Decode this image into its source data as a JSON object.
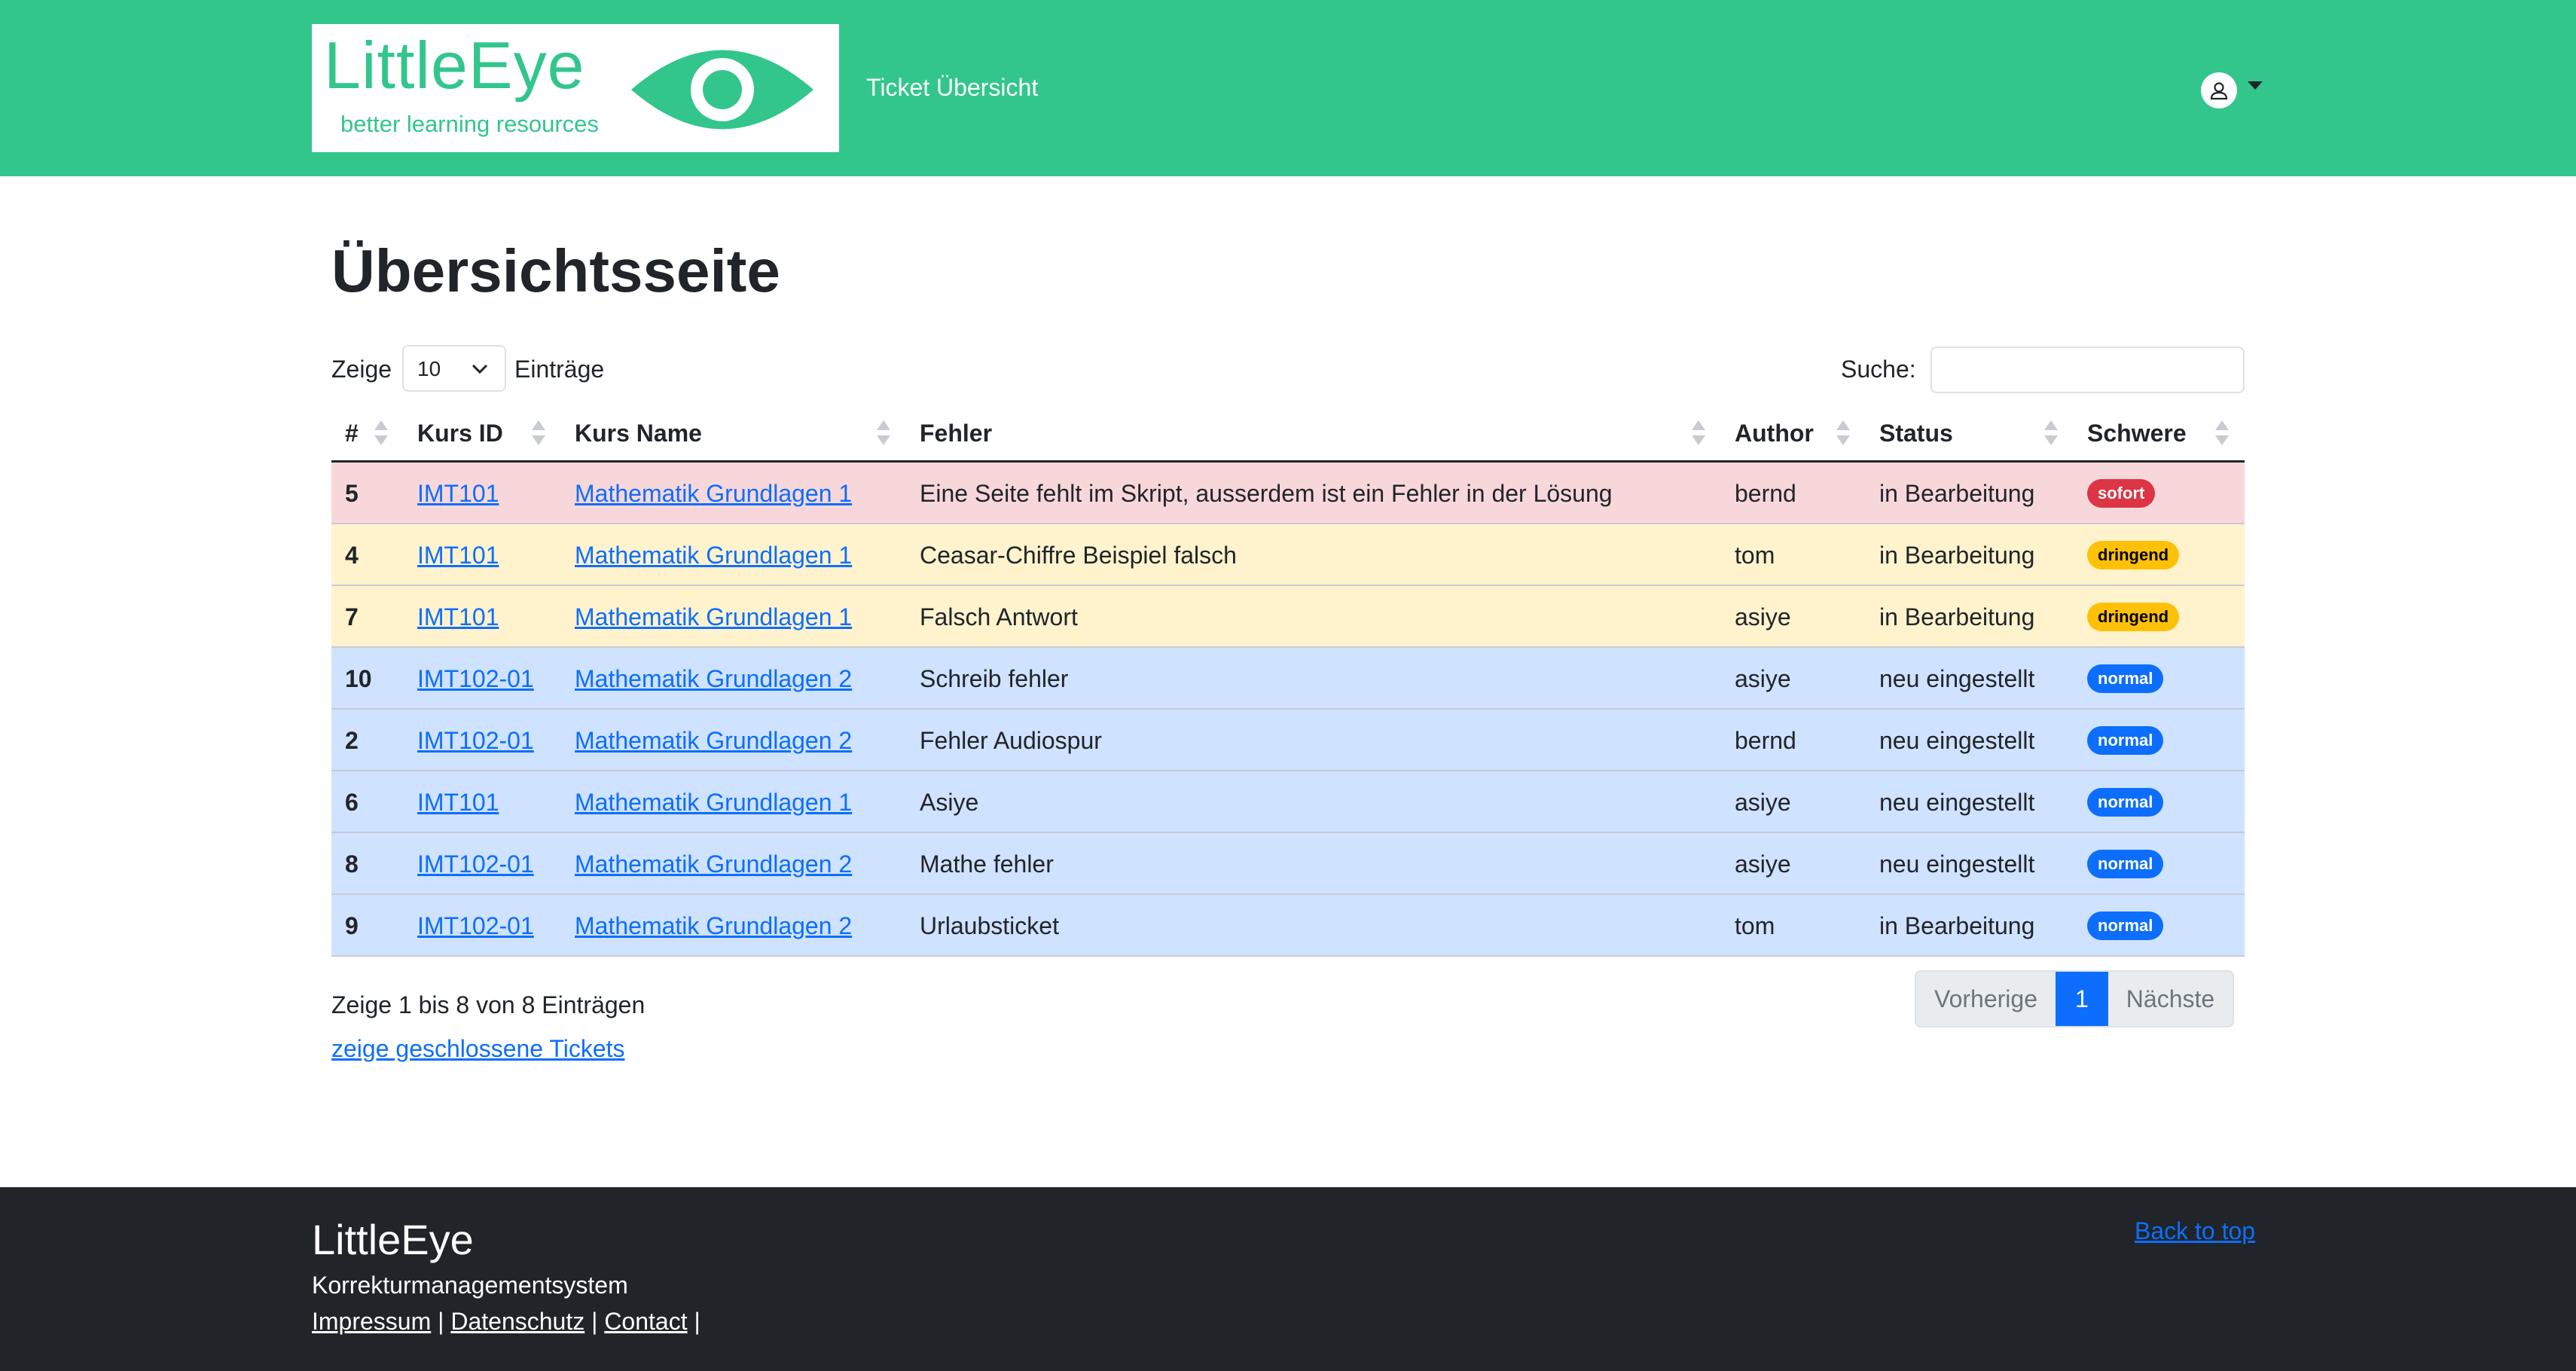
{
  "header": {
    "logo_title": "LittleEye",
    "logo_subtitle": "better learning resources",
    "nav_link": "Ticket Übersicht",
    "user_icon": "person-circle-icon"
  },
  "main": {
    "title": "Übersichtsseite",
    "length_prefix": "Zeige",
    "length_value": "10",
    "length_suffix": "Einträge",
    "search_label": "Suche:",
    "search_value": "",
    "columns": [
      "#",
      "Kurs ID",
      "Kurs Name",
      "Fehler",
      "Author",
      "Status",
      "Schwere"
    ],
    "rows": [
      {
        "id": "5",
        "kurs_id": "IMT101",
        "kurs_name": "Mathematik Grundlagen 1",
        "fehler": "Eine Seite fehlt im Skript, ausserdem ist ein Fehler in der Lösung",
        "author": "bernd",
        "status": "in Bearbeitung",
        "schwere": "sofort",
        "level": "danger"
      },
      {
        "id": "4",
        "kurs_id": "IMT101",
        "kurs_name": "Mathematik Grundlagen 1",
        "fehler": "Ceasar-Chiffre Beispiel falsch",
        "author": "tom",
        "status": "in Bearbeitung",
        "schwere": "dringend",
        "level": "warning"
      },
      {
        "id": "7",
        "kurs_id": "IMT101",
        "kurs_name": "Mathematik Grundlagen 1",
        "fehler": "Falsch Antwort",
        "author": "asiye",
        "status": "in Bearbeitung",
        "schwere": "dringend",
        "level": "warning"
      },
      {
        "id": "10",
        "kurs_id": "IMT102-01",
        "kurs_name": "Mathematik Grundlagen 2",
        "fehler": "Schreib fehler",
        "author": "asiye",
        "status": "neu eingestellt",
        "schwere": "normal",
        "level": "primary"
      },
      {
        "id": "2",
        "kurs_id": "IMT102-01",
        "kurs_name": "Mathematik Grundlagen 2",
        "fehler": "Fehler Audiospur",
        "author": "bernd",
        "status": "neu eingestellt",
        "schwere": "normal",
        "level": "primary"
      },
      {
        "id": "6",
        "kurs_id": "IMT101",
        "kurs_name": "Mathematik Grundlagen 1",
        "fehler": "Asiye",
        "author": "asiye",
        "status": "neu eingestellt",
        "schwere": "normal",
        "level": "primary"
      },
      {
        "id": "8",
        "kurs_id": "IMT102-01",
        "kurs_name": "Mathematik Grundlagen 2",
        "fehler": "Mathe fehler",
        "author": "asiye",
        "status": "neu eingestellt",
        "schwere": "normal",
        "level": "primary"
      },
      {
        "id": "9",
        "kurs_id": "IMT102-01",
        "kurs_name": "Mathematik Grundlagen 2",
        "fehler": "Urlaubsticket",
        "author": "tom",
        "status": "in Bearbeitung",
        "schwere": "normal",
        "level": "primary"
      }
    ],
    "info": "Zeige 1 bis 8 von 8 Einträgen",
    "closed_link": "zeige geschlossene Tickets",
    "pagination": {
      "prev": "Vorherige",
      "current": "1",
      "next": "Nächste"
    }
  },
  "footer": {
    "title": "LittleEye",
    "subtitle": "Korrekturmanagementsystem",
    "links": [
      "Impressum",
      "Datenschutz",
      "Contact"
    ],
    "separator": "|",
    "back_to_top": "Back to top"
  },
  "colors": {
    "brand": "#32c68c",
    "link": "#0d6efd",
    "footer_bg": "#212529",
    "row_danger": "#f8d7da",
    "row_warning": "#fff3cd",
    "row_primary": "#cfe2ff"
  }
}
